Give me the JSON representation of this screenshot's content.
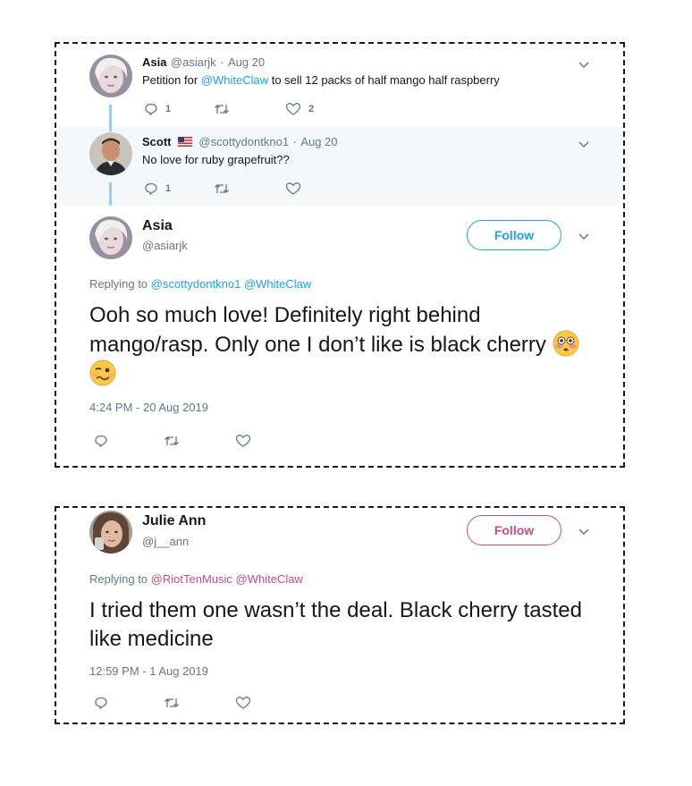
{
  "tweet1": {
    "name": "Asia",
    "handle": "@asiarjk",
    "sep": "·",
    "date": "Aug 20",
    "text_pre": "Petition for ",
    "mention": "@WhiteClaw",
    "text_post": " to sell 12 packs of half mango half raspberry",
    "reply_count": "1",
    "retweet_count": "",
    "like_count": "2"
  },
  "tweet2": {
    "name": "Scott",
    "handle": "@scottydontkno1",
    "sep": "·",
    "date": "Aug 20",
    "text": "No love for ruby grapefruit??",
    "reply_count": "1",
    "retweet_count": "",
    "like_count": ""
  },
  "focus1": {
    "name": "Asia",
    "handle": "@asiarjk",
    "follow_label": "Follow",
    "replying_label": "Replying to",
    "mention1": "@scottydontkno1",
    "mention2": "@WhiteClaw",
    "text": "Ooh so much love! Definitely right behind mango/rasp. Only one I don’t like is black cherry",
    "timestamp": "4:24 PM - 20 Aug 2019"
  },
  "focus2": {
    "name": "Julie Ann",
    "handle": "@j__ann",
    "follow_label": "Follow",
    "replying_label": "Replying to",
    "mention1": "@RiotTenMusic",
    "mention2": "@WhiteClaw",
    "text": "I tried them one wasn’t the deal. Black cherry tasted like medicine",
    "timestamp": "12:59 PM - 1 Aug 2019"
  },
  "icons": [
    "reply-icon",
    "retweet-icon",
    "like-icon",
    "chevron-down-icon",
    "us-flag-icon",
    "flushed-face-emoji",
    "woozy-face-emoji"
  ],
  "colors": {
    "link_blue": "#1da1f2",
    "link_pink": "#c84d7f",
    "thread_line": "#9dcde8",
    "shaded_bg": "#f5f8fa",
    "muted": "#657786"
  }
}
